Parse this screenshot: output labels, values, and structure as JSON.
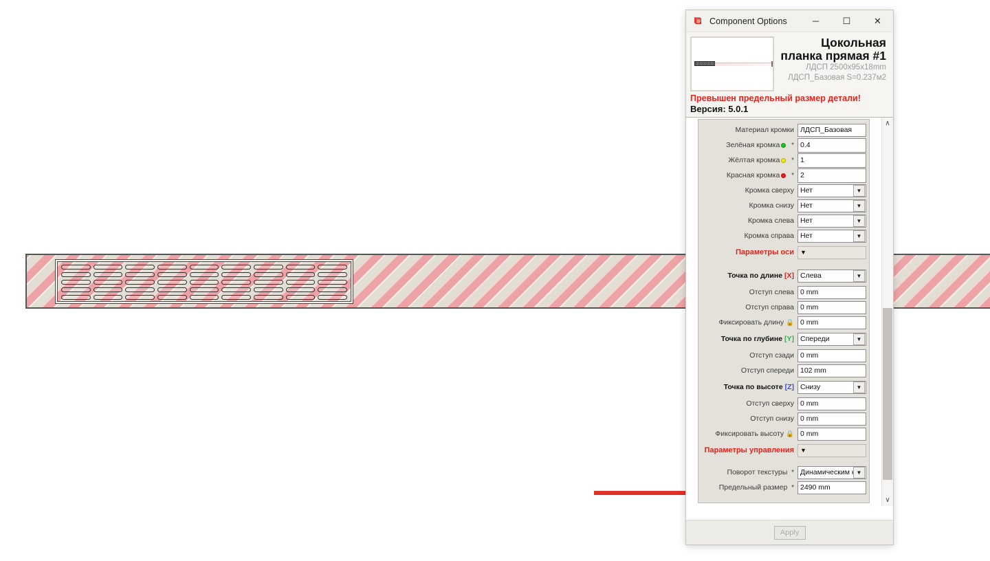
{
  "window": {
    "title": "Component Options",
    "icon": "sketchup-icon",
    "minimize_label": "─",
    "maximize_label": "☐",
    "close_label": "✕"
  },
  "header": {
    "part_title": "Цокольная планка прямая #1",
    "meta_line_1": "ЛДСП  2500x95x18mm",
    "meta_line_2": "ЛДСП_Базовая  S=0.237м2",
    "warning": "Превышен предельный размер детали!",
    "version": "Версия: 5.0.1",
    "warning_color": "#e8211a"
  },
  "form": {
    "rows": [
      {
        "label": "Материал кромки",
        "value": "ЛДСП_Базовая",
        "type": "text"
      },
      {
        "label": "Зелёная кромка",
        "value": "0.4",
        "type": "text",
        "dot": "green",
        "asterisk": "*"
      },
      {
        "label": "Жёлтая кромка",
        "value": "1",
        "type": "text",
        "dot": "yellow",
        "asterisk": "*"
      },
      {
        "label": "Красная кромка",
        "value": "2",
        "type": "text",
        "dot": "red",
        "asterisk": "*"
      },
      {
        "label": "Кромка сверху",
        "value": "Нет",
        "type": "select"
      },
      {
        "label": "Кромка снизу",
        "value": "Нет",
        "type": "select"
      },
      {
        "label": "Кромка слева",
        "value": "Нет",
        "type": "select"
      },
      {
        "label": "Кромка справа",
        "value": "Нет",
        "type": "select"
      },
      {
        "label": "Параметры оси",
        "value": "▼",
        "type": "section"
      },
      {
        "label": "Точка по длине",
        "value": "Слева",
        "type": "select",
        "bold": true,
        "axis": "X",
        "axis_class": "x"
      },
      {
        "label": "Отступ слева",
        "value": "0 mm",
        "type": "text"
      },
      {
        "label": "Отступ справа",
        "value": "0 mm",
        "type": "text"
      },
      {
        "label": "Фиксировать длину",
        "value": "0 mm",
        "type": "text",
        "lock": true
      },
      {
        "label": "Точка по глубине",
        "value": "Спереди",
        "type": "select",
        "bold": true,
        "axis": "Y",
        "axis_class": "y"
      },
      {
        "label": "Отступ сзади",
        "value": "0 mm",
        "type": "text"
      },
      {
        "label": "Отступ спереди",
        "value": "102 mm",
        "type": "text"
      },
      {
        "label": "Точка по высоте",
        "value": "Снизу",
        "type": "select",
        "bold": true,
        "axis": "Z",
        "axis_class": "z"
      },
      {
        "label": "Отступ сверху",
        "value": "0 mm",
        "type": "text"
      },
      {
        "label": "Отступ снизу",
        "value": "0 mm",
        "type": "text"
      },
      {
        "label": "Фиксировать высоту",
        "value": "0 mm",
        "type": "text",
        "lock": true
      },
      {
        "label": "Параметры управления",
        "value": "▼",
        "type": "section"
      },
      {
        "label": "Поворот текстуры",
        "value": "Динамическим к.",
        "type": "select",
        "asterisk": "*"
      },
      {
        "label": "Предельный размер",
        "value": "2490 mm",
        "type": "text",
        "asterisk": "*",
        "highlighted": true
      }
    ]
  },
  "scrollbar": {
    "up_label": "∧",
    "down_label": "∨"
  },
  "footer": {
    "apply_label": "Apply",
    "apply_enabled": false
  },
  "viewport": {
    "annotation": "red-arrow-pointing-to-limit-size-field",
    "board_label": "hatched-panel-with-ventilation-slots",
    "hatch_color_pink": "#eda3a5",
    "hatch_color_gray": "#e3ded4",
    "vent_columns": 9,
    "vent_rows": 5
  }
}
